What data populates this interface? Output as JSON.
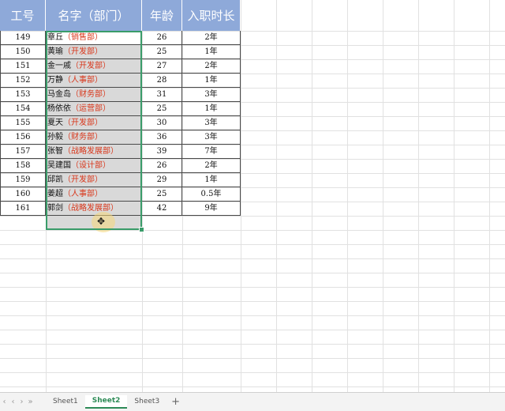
{
  "headers": {
    "id": "工号",
    "name": "名字（部门）",
    "age": "年龄",
    "tenure": "入职时长"
  },
  "rows": [
    {
      "id": "149",
      "name": "章丘",
      "dept": "（销售部）",
      "age": "26",
      "tenure": "2年"
    },
    {
      "id": "150",
      "name": "黄瑜",
      "dept": "（开发部）",
      "age": "25",
      "tenure": "1年"
    },
    {
      "id": "151",
      "name": "金一戚",
      "dept": "（开发部）",
      "age": "27",
      "tenure": "2年"
    },
    {
      "id": "152",
      "name": "万静",
      "dept": "（人事部）",
      "age": "28",
      "tenure": "1年"
    },
    {
      "id": "153",
      "name": "马金岛",
      "dept": "（财务部）",
      "age": "31",
      "tenure": "3年"
    },
    {
      "id": "154",
      "name": "杨依依",
      "dept": "（运营部）",
      "age": "25",
      "tenure": "1年"
    },
    {
      "id": "155",
      "name": "夏天",
      "dept": "（开发部）",
      "age": "30",
      "tenure": "3年"
    },
    {
      "id": "156",
      "name": "孙毅",
      "dept": "（财务部）",
      "age": "36",
      "tenure": "3年"
    },
    {
      "id": "157",
      "name": "张智",
      "dept": "（战略发展部）",
      "age": "39",
      "tenure": "7年"
    },
    {
      "id": "158",
      "name": "吴建国",
      "dept": "（设计部）",
      "age": "26",
      "tenure": "2年"
    },
    {
      "id": "159",
      "name": "邱凯",
      "dept": "（开发部）",
      "age": "29",
      "tenure": "1年"
    },
    {
      "id": "160",
      "name": "姜超",
      "dept": "（人事部）",
      "age": "25",
      "tenure": "0.5年"
    },
    {
      "id": "161",
      "name": "郭剑",
      "dept": "（战略发展部）",
      "age": "42",
      "tenure": "9年"
    }
  ],
  "sheet_tabs": [
    "Sheet1",
    "Sheet2",
    "Sheet3"
  ],
  "active_sheet": "Sheet2",
  "nav_icons": [
    "first-sheet-icon",
    "prev-sheet-icon",
    "next-sheet-icon",
    "last-sheet-icon"
  ],
  "add_sheet": "+",
  "cursor_glyph": "✥",
  "colors": {
    "header_bg": "#8ea9d9",
    "dept_text": "#d9361a",
    "selection_border": "#3a9c6a",
    "selected_fill": "#d9d9d9"
  }
}
